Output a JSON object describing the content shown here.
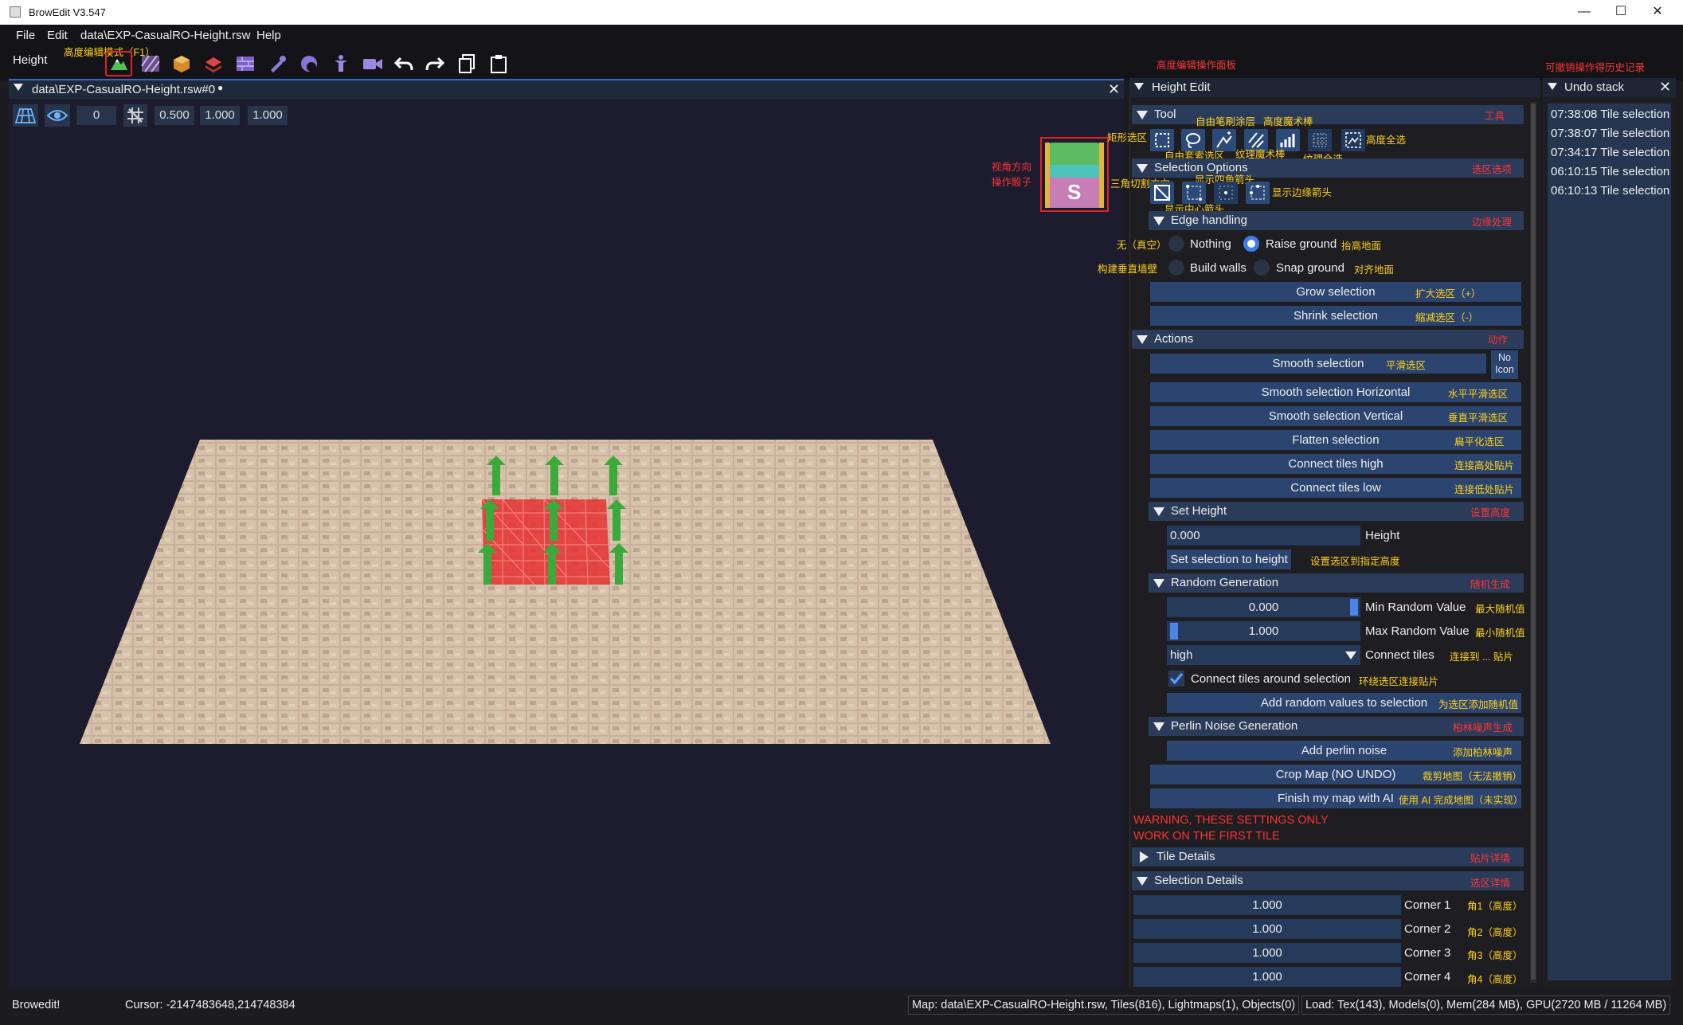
{
  "window": {
    "title": "BrowEdit V3.547",
    "min": "—",
    "max": "☐",
    "close": "✕"
  },
  "menu": [
    "File",
    "Edit",
    "data\\EXP-CasualRO-Height.rsw",
    "Help"
  ],
  "toolbar": {
    "mode_label": "Height",
    "annotation_mode": "高度编辑模式（F1）"
  },
  "annotations_top": {
    "height_panel": "高度编辑操作面板",
    "undo_history": "可撤销操作得历史记录"
  },
  "viewport": {
    "tab_title": "data\\EXP-CasualRO-Height.rsw#0",
    "tab_dot": "●",
    "vals": [
      "0",
      "0.500",
      "1.000",
      "1.000"
    ],
    "cube_annotation_1": "视角方向",
    "cube_annotation_2": "操作骰子",
    "cube_letter": "S"
  },
  "panel": {
    "title": "Height Edit",
    "tool": {
      "label": "Tool",
      "note": "工具",
      "ann_rect": "矩形选区",
      "ann_brush": "自由笔刷涂层",
      "ann_wand": "高度魔术棒",
      "ann_lasso": "自由套索选区",
      "ann_tex_wand": "纹理魔术棒",
      "ann_tex_all": "纹理全选",
      "ann_all": "高度全选"
    },
    "selection_options": {
      "label": "Selection Options",
      "note": "选区选项",
      "ann_tri": "三角切割方向",
      "ann_corner": "显示四角箭头",
      "ann_center": "显示中心箭头",
      "ann_edge": "显示边缘箭头"
    },
    "edge": {
      "label": "Edge handling",
      "note": "边缘处理",
      "nothing": "Nothing",
      "nothing_ann": "无（真空）",
      "raise": "Raise ground",
      "raise_ann": "抬高地面",
      "walls": "Build walls",
      "walls_ann": "构建垂直墙壁",
      "snap": "Snap ground",
      "snap_ann": "对齐地面"
    },
    "grow": "Grow selection",
    "grow_ann": "扩大选区（+）",
    "shrink": "Shrink selection",
    "shrink_ann": "缩减选区（-）",
    "actions": {
      "label": "Actions",
      "note": "动作"
    },
    "smooth": "Smooth selection",
    "smooth_ann": "平滑选区",
    "noicon": "No Icon",
    "smooth_h": "Smooth selection Horizontal",
    "smooth_h_ann": "水平平滑选区",
    "smooth_v": "Smooth selection Vertical",
    "smooth_v_ann": "垂直平滑选区",
    "flatten": "Flatten selection",
    "flatten_ann": "扁平化选区",
    "conn_high": "Connect tiles high",
    "conn_high_ann": "连接高处贴片",
    "conn_low": "Connect tiles low",
    "conn_low_ann": "连接低处贴片",
    "set_height": {
      "label": "Set Height",
      "note": "设置高度",
      "value": "0.000",
      "field_label": "Height",
      "button": "Set selection to height",
      "button_ann": "设置选区到指定高度"
    },
    "random": {
      "label": "Random Generation",
      "note": "随机生成",
      "min": "0.000",
      "min_label": "Min Random Value",
      "min_ann": "最大随机值",
      "max": "1.000",
      "max_label": "Max Random Value",
      "max_ann": "最小随机值",
      "connect": "high",
      "connect_label": "Connect tiles",
      "connect_ann": "连接到 ... 贴片",
      "around": "Connect tiles around selection",
      "around_ann": "环绕选区连接贴片",
      "add": "Add random values to selection",
      "add_ann": "为选区添加随机值"
    },
    "perlin": {
      "label": "Perlin Noise Generation",
      "note": "柏林噪声生成",
      "add": "Add perlin noise",
      "add_ann": "添加柏林噪声"
    },
    "crop": "Crop Map (NO UNDO)",
    "crop_ann": "裁剪地图（无法撤销）",
    "finish": "Finish my map with AI",
    "finish_ann": "使用 AI 完成地图（未实现）",
    "warning1": "WARNING, THESE SETTINGS ONLY",
    "warning2": "WORK ON THE FIRST TILE",
    "tile_details": {
      "label": "Tile Details",
      "note": "贴片详情"
    },
    "selection_details": {
      "label": "Selection Details",
      "note": "选区详情",
      "corners": [
        {
          "value": "1.000",
          "label": "Corner 1",
          "ann": "角1（高度）"
        },
        {
          "value": "1.000",
          "label": "Corner 2",
          "ann": "角2（高度）"
        },
        {
          "value": "1.000",
          "label": "Corner 3",
          "ann": "角3（高度）"
        },
        {
          "value": "1.000",
          "label": "Corner 4",
          "ann": "角4（高度）"
        }
      ]
    }
  },
  "undo": {
    "title": "Undo stack",
    "items": [
      "07:38:08 Tile selection",
      "07:38:07 Tile selection",
      "07:34:17 Tile selection",
      "06:10:15 Tile selection",
      "06:10:13 Tile selection"
    ]
  },
  "status": {
    "app": "Browedit!",
    "cursor": "Cursor: -2147483648,214748384",
    "map": "Map: data\\EXP-CasualRO-Height.rsw, Tiles(816), Lightmaps(1), Objects(0)",
    "load": "Load: Tex(143), Models(0), Mem(284 MB), GPU(2720 MB / 11264 MB)"
  }
}
